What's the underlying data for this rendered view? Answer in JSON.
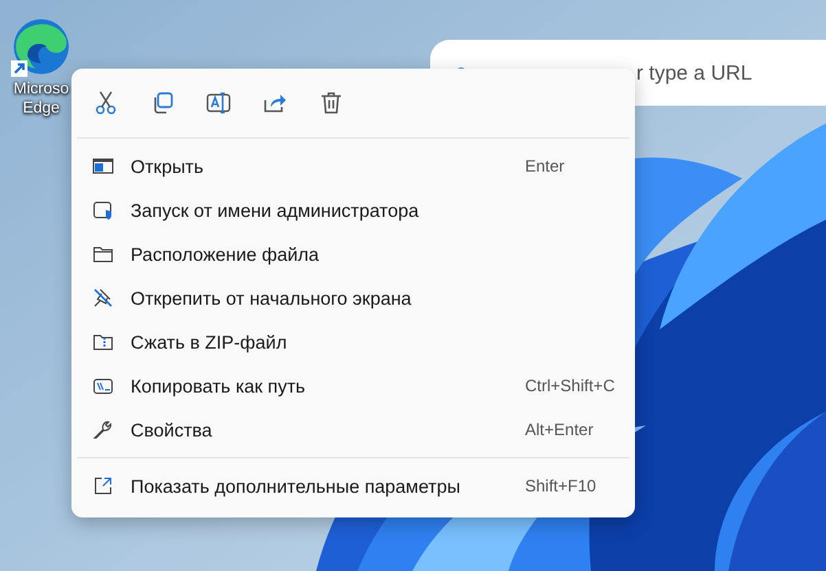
{
  "desktop_icon": {
    "label_lines": [
      "Microso",
      "Edge"
    ]
  },
  "search_bar": {
    "placeholder": "r type a URL"
  },
  "context_menu": {
    "groups": [
      [
        {
          "label": "Открыть",
          "shortcut": "Enter"
        },
        {
          "label": "Запуск от имени администратора"
        },
        {
          "label": "Расположение файла"
        },
        {
          "label": "Открепить от начального экрана"
        },
        {
          "label": "Сжать в ZIP-файл"
        },
        {
          "label": "Копировать как путь",
          "shortcut": "Ctrl+Shift+C"
        },
        {
          "label": "Свойства",
          "shortcut": "Alt+Enter"
        }
      ],
      [
        {
          "label": "Показать дополнительные параметры",
          "shortcut": "Shift+F10"
        }
      ]
    ]
  }
}
